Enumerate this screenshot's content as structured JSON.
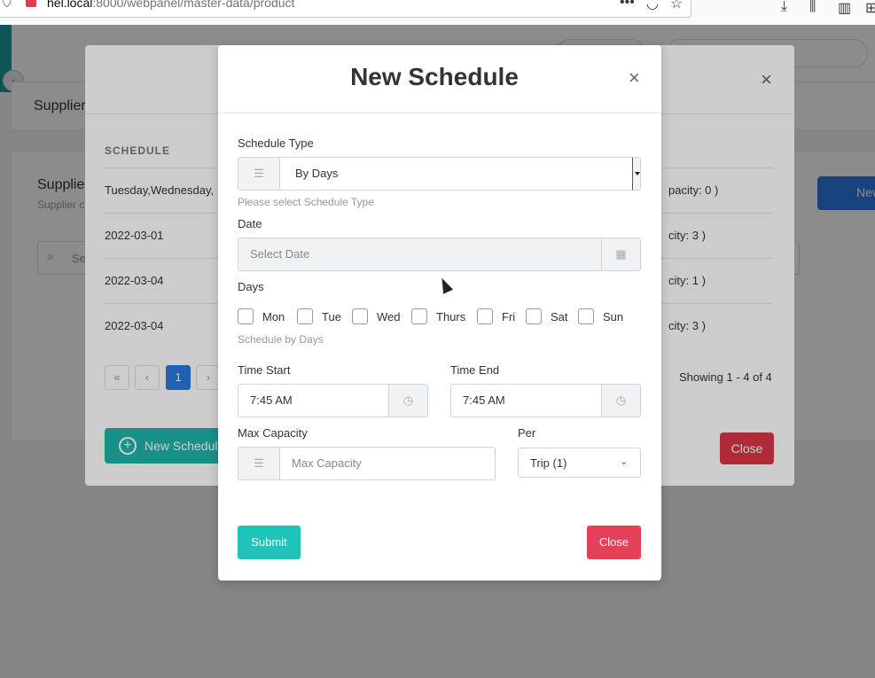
{
  "browser": {
    "url_host": "hel.local",
    "url_path": ":8000/webpanel/master-data/product",
    "icons": [
      "shield-icon",
      "favicon",
      "more-icon",
      "pocket-icon",
      "bookmark-star-icon",
      "download-icon",
      "library-icon",
      "sidebar-icon"
    ]
  },
  "page": {
    "subheader_title": "Supplier",
    "card_title": "Supplie",
    "card_subtitle": "Supplier c",
    "search_placeholder": "Se",
    "new_button": "Nev"
  },
  "schedule_list_modal": {
    "column_header": "SCHEDULE",
    "rows": [
      {
        "schedule": "Tuesday,Wednesday,",
        "capacity": "pacity: 0 )"
      },
      {
        "schedule": "2022-03-01",
        "capacity": "city: 3 )"
      },
      {
        "schedule": "2022-03-04",
        "capacity": "city: 1 )"
      },
      {
        "schedule": "2022-03-04",
        "capacity": "city: 3 )"
      }
    ],
    "pagination": {
      "first": "«",
      "prev": "‹",
      "current": "1",
      "next": "›"
    },
    "showing": "Showing 1 - 4 of 4",
    "new_schedule_button": "New Schedule",
    "close_button": "Close"
  },
  "new_schedule_modal": {
    "title": "New Schedule",
    "schedule_type_label": "Schedule Type",
    "schedule_type_value": "By Days",
    "schedule_type_hint": "Please select Schedule Type",
    "date_label": "Date",
    "date_placeholder": "Select Date",
    "days_label": "Days",
    "days": [
      "Mon",
      "Tue",
      "Wed",
      "Thurs",
      "Fri",
      "Sat",
      "Sun"
    ],
    "days_hint": "Schedule by Days",
    "time_start_label": "Time Start",
    "time_start_value": "7:45 AM",
    "time_end_label": "Time End",
    "time_end_value": "7:45 AM",
    "max_capacity_label": "Max Capacity",
    "max_capacity_placeholder": "Max Capacity",
    "per_label": "Per",
    "per_value": "Trip (1)",
    "submit_button": "Submit",
    "close_button": "Close"
  }
}
